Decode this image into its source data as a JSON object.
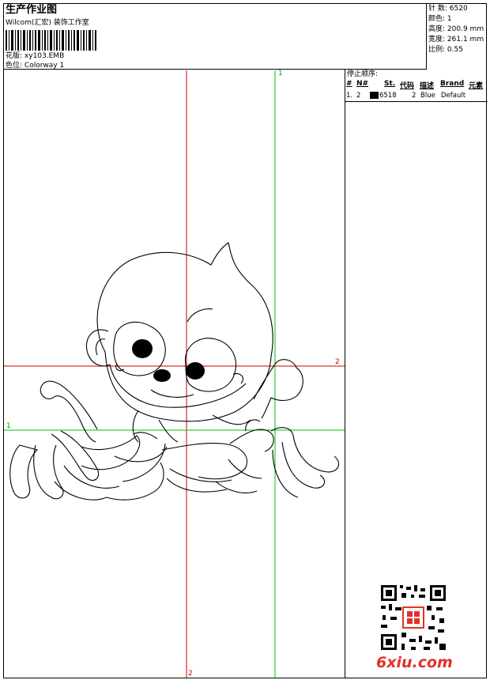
{
  "header": {
    "title": "生产作业图",
    "studio": "Wilcom(汇宏) 装饰工作室",
    "design_label": "花版:",
    "design_value": "xy103.EMB",
    "colorway_label": "色位:",
    "colorway_value": "Colorway 1"
  },
  "stats": [
    {
      "label": "针 数:",
      "value": "6520"
    },
    {
      "label": "颜色:",
      "value": "1"
    },
    {
      "label": "高度:",
      "value": "200.9 mm"
    },
    {
      "label": "宽度:",
      "value": "261.1 mm"
    },
    {
      "label": "比例:",
      "value": "0.55"
    }
  ],
  "stop_sequence": {
    "title": "停止顺序:",
    "columns": [
      "#",
      "N#",
      "St.",
      "代码",
      "描述",
      "Brand",
      "元素"
    ],
    "rows": [
      {
        "num": "1.",
        "needle": "2",
        "stitches": "6518",
        "code": "2",
        "desc": "Blue",
        "brand": "Default",
        "swatch_color": "#000000"
      }
    ]
  },
  "guides": {
    "red_top": "1",
    "red_bottom": "2",
    "red_right": "2",
    "green_left": "1"
  },
  "watermark": {
    "site": "6xiu.com",
    "qr_icon": "qr-code-icon",
    "seal_icon": "red-seal-icon"
  },
  "colors": {
    "red_guide": "#d00000",
    "green_guide": "#00c000",
    "watermark": "#e0322a"
  }
}
